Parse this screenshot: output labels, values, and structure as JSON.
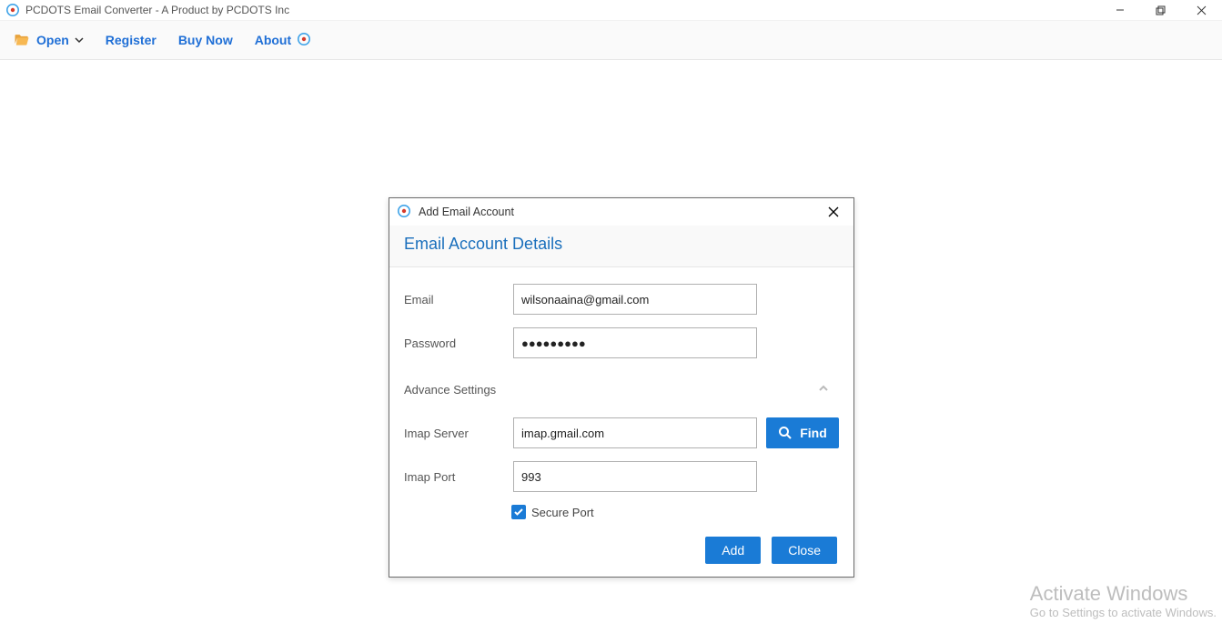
{
  "window": {
    "title": "PCDOTS Email Converter - A Product by PCDOTS Inc"
  },
  "toolbar": {
    "open": "Open",
    "register": "Register",
    "buynow": "Buy Now",
    "about": "About"
  },
  "dialog": {
    "title": "Add Email Account",
    "panel_title": "Email Account Details",
    "labels": {
      "email": "Email",
      "password": "Password",
      "advance": "Advance Settings",
      "imap_server": "Imap Server",
      "imap_port": "Imap Port",
      "secure_port": "Secure Port"
    },
    "values": {
      "email": "wilsonaaina@gmail.com",
      "password": "●●●●●●●●●",
      "imap_server": "imap.gmail.com",
      "imap_port": "993",
      "secure_port_checked": true
    },
    "buttons": {
      "find": "Find",
      "add": "Add",
      "close": "Close"
    }
  },
  "watermark": {
    "line1": "Activate Windows",
    "line2": "Go to Settings to activate Windows."
  },
  "colors": {
    "accent": "#1a7bd6",
    "link": "#1f6fd6"
  }
}
